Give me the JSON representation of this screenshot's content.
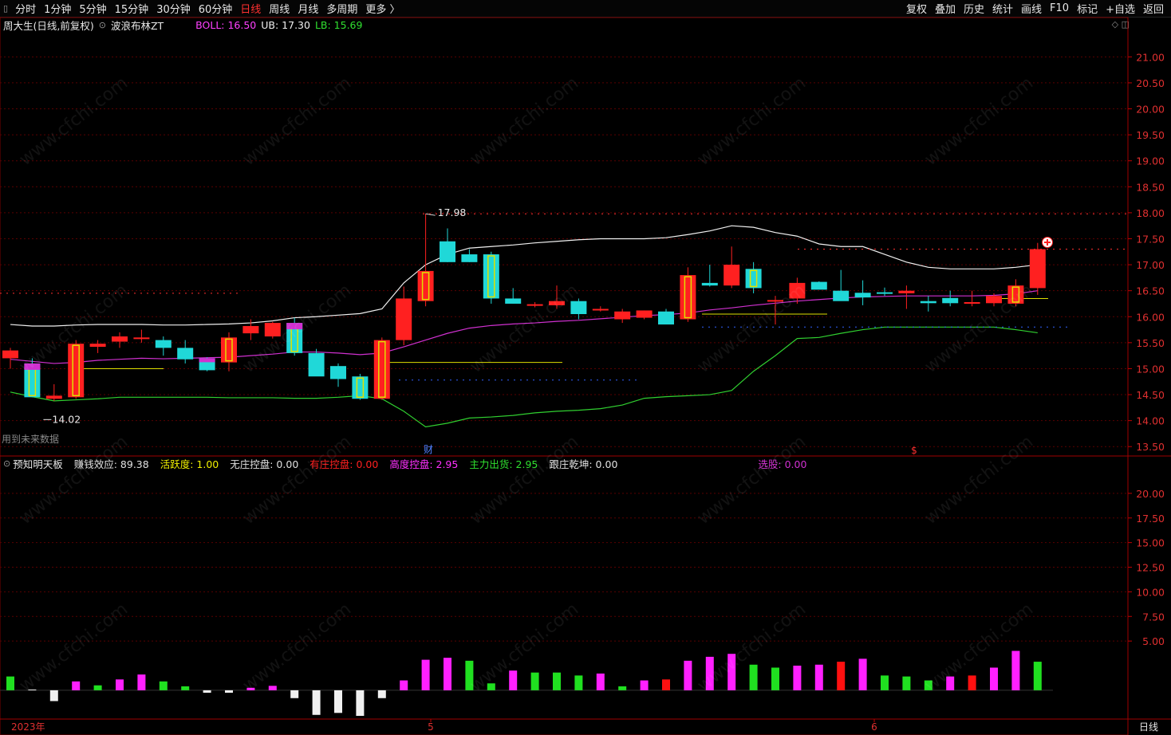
{
  "toolbar": {
    "left": [
      "分时",
      "1分钟",
      "5分钟",
      "15分钟",
      "30分钟",
      "60分钟",
      "日线",
      "周线",
      "月线",
      "多周期",
      "更多 〉"
    ],
    "active": "日线",
    "right": [
      "复权",
      "叠加",
      "历史",
      "统计",
      "画线",
      "F10",
      "标记",
      "+自选",
      "返回"
    ]
  },
  "main_info": {
    "stock": "周大生(日线,前复权)",
    "indicator": "波浪布林ZT",
    "boll_label": "BOLL: 16.50",
    "ub_label": "UB: 17.30",
    "lb_label": "LB: 15.69"
  },
  "sub_info": {
    "name": "预知明天板",
    "items": [
      {
        "text": "赚钱效应: 89.38",
        "color": "#e0e0e0"
      },
      {
        "text": "活跃度: 1.00",
        "color": "#f0f000"
      },
      {
        "text": "无庄控盘: 0.00",
        "color": "#e0e0e0"
      },
      {
        "text": "有庄控盘: 0.00",
        "color": "#ff2020"
      },
      {
        "text": "高度控盘: 2.95",
        "color": "#ff30ff"
      },
      {
        "text": "主力出货: 2.95",
        "color": "#30e030"
      },
      {
        "text": "跟庄乾坤: 0.00",
        "color": "#e0e0e0"
      }
    ],
    "select_label": "选股: 0.00"
  },
  "annotations": {
    "high_label": "17.98",
    "low_label": "14.02",
    "future_note": "用到未来数据",
    "cai": "财",
    "dollar": "$"
  },
  "x_labels": {
    "start": "2023年",
    "m5": "5",
    "m6": "6",
    "period": "日线"
  },
  "watermark": "www.cfchi.com",
  "colors": {
    "up": "#ff2020",
    "down": "#20d8d8",
    "mid": "#d030d0",
    "upper": "#f0f0f0",
    "lower": "#30d030",
    "yellow": "#e0e000"
  },
  "chart_data": [
    {
      "type": "candlestick",
      "title": "周大生(日线,前复权) 波浪布林ZT",
      "ylim": [
        13.35,
        21.45
      ],
      "y_ticks": [
        "21.00",
        "20.50",
        "20.00",
        "19.50",
        "19.00",
        "18.50",
        "18.00",
        "17.50",
        "17.00",
        "16.50",
        "16.00",
        "15.50",
        "15.00",
        "14.50",
        "14.00",
        "13.50"
      ],
      "ohlc": [
        [
          15.2,
          15.4,
          15.0,
          15.35
        ],
        [
          15.1,
          15.2,
          14.45,
          14.45
        ],
        [
          14.42,
          14.7,
          14.38,
          14.48
        ],
        [
          14.45,
          15.55,
          14.42,
          15.48
        ],
        [
          15.42,
          15.55,
          15.3,
          15.48
        ],
        [
          15.52,
          15.7,
          15.4,
          15.62
        ],
        [
          15.58,
          15.75,
          15.5,
          15.6
        ],
        [
          15.55,
          15.62,
          15.25,
          15.4
        ],
        [
          15.4,
          15.55,
          15.1,
          15.18
        ],
        [
          15.2,
          15.22,
          14.95,
          14.97
        ],
        [
          15.12,
          15.7,
          14.95,
          15.6
        ],
        [
          15.68,
          15.95,
          15.55,
          15.82
        ],
        [
          15.62,
          15.9,
          15.58,
          15.88
        ],
        [
          15.88,
          15.98,
          15.25,
          15.3
        ],
        [
          15.3,
          15.38,
          14.9,
          14.85
        ],
        [
          15.05,
          15.1,
          14.65,
          14.8
        ],
        [
          14.85,
          14.9,
          14.4,
          14.42
        ],
        [
          14.42,
          15.6,
          14.4,
          15.55
        ],
        [
          15.55,
          16.58,
          15.45,
          16.35
        ],
        [
          16.3,
          17.98,
          16.2,
          16.88
        ],
        [
          17.45,
          17.7,
          17.05,
          17.05
        ],
        [
          17.2,
          17.3,
          17.05,
          17.05
        ],
        [
          17.2,
          17.25,
          16.25,
          16.35
        ],
        [
          16.35,
          16.55,
          16.25,
          16.25
        ],
        [
          16.22,
          16.28,
          16.18,
          16.24
        ],
        [
          16.22,
          16.6,
          16.15,
          16.3
        ],
        [
          16.3,
          16.35,
          15.95,
          16.05
        ],
        [
          16.15,
          16.2,
          16.1,
          16.15
        ],
        [
          15.95,
          16.15,
          15.88,
          16.1
        ],
        [
          15.98,
          16.12,
          15.95,
          16.12
        ],
        [
          16.1,
          16.15,
          15.88,
          15.85
        ],
        [
          15.95,
          16.95,
          15.9,
          16.8
        ],
        [
          16.65,
          17.0,
          16.58,
          16.6
        ],
        [
          16.6,
          17.35,
          16.55,
          17.0
        ],
        [
          16.92,
          17.05,
          16.45,
          16.55
        ],
        [
          16.32,
          16.4,
          15.85,
          16.32
        ],
        [
          16.35,
          16.75,
          16.25,
          16.65
        ],
        [
          16.67,
          16.68,
          16.55,
          16.52
        ],
        [
          16.5,
          16.9,
          16.4,
          16.3
        ],
        [
          16.46,
          16.7,
          16.22,
          16.37
        ],
        [
          16.47,
          16.56,
          16.4,
          16.44
        ],
        [
          16.45,
          16.6,
          16.15,
          16.5
        ],
        [
          16.3,
          16.4,
          16.1,
          16.26
        ],
        [
          16.36,
          16.5,
          16.2,
          16.26
        ],
        [
          16.26,
          16.5,
          16.2,
          16.28
        ],
        [
          16.26,
          16.45,
          16.2,
          16.4
        ],
        [
          16.25,
          16.72,
          16.2,
          16.6
        ],
        [
          16.55,
          17.42,
          16.42,
          17.3
        ]
      ],
      "boll_mid": [
        15.18,
        15.14,
        15.1,
        15.12,
        15.16,
        15.18,
        15.2,
        15.19,
        15.2,
        15.21,
        15.22,
        15.25,
        15.28,
        15.32,
        15.32,
        15.3,
        15.27,
        15.3,
        15.42,
        15.55,
        15.68,
        15.78,
        15.83,
        15.86,
        15.88,
        15.91,
        15.93,
        15.96,
        15.99,
        16.02,
        16.04,
        16.07,
        16.13,
        16.17,
        16.22,
        16.26,
        16.3,
        16.33,
        16.36,
        16.38,
        16.39,
        16.4,
        16.4,
        16.4,
        16.4,
        16.41,
        16.44,
        16.5
      ],
      "boll_upper": [
        15.85,
        15.82,
        15.82,
        15.84,
        15.85,
        15.85,
        15.85,
        15.84,
        15.84,
        15.85,
        15.86,
        15.88,
        15.92,
        15.98,
        16.0,
        16.03,
        16.06,
        16.15,
        16.65,
        17.0,
        17.2,
        17.32,
        17.35,
        17.38,
        17.42,
        17.45,
        17.48,
        17.5,
        17.5,
        17.5,
        17.52,
        17.58,
        17.65,
        17.75,
        17.72,
        17.62,
        17.55,
        17.4,
        17.35,
        17.35,
        17.2,
        17.05,
        16.95,
        16.92,
        16.92,
        16.92,
        16.95,
        17.0
      ],
      "boll_lower": [
        14.55,
        14.46,
        14.38,
        14.4,
        14.42,
        14.45,
        14.45,
        14.45,
        14.45,
        14.45,
        14.44,
        14.44,
        14.44,
        14.43,
        14.43,
        14.45,
        14.48,
        14.42,
        14.18,
        13.88,
        13.95,
        14.05,
        14.07,
        14.1,
        14.15,
        14.18,
        14.2,
        14.23,
        14.3,
        14.43,
        14.46,
        14.48,
        14.5,
        14.58,
        14.95,
        15.25,
        15.58,
        15.6,
        15.68,
        15.75,
        15.8,
        15.8,
        15.8,
        15.8,
        15.8,
        15.8,
        15.75,
        15.69
      ],
      "ub": 17.3,
      "boll": 16.5,
      "lb": 15.69
    },
    {
      "type": "bar",
      "title": "预知明天板",
      "ylim": [
        -2.6,
        22.5
      ],
      "y_ticks": [
        "20.00",
        "17.50",
        "15.00",
        "12.50",
        "10.00",
        "7.50",
        "5.00"
      ],
      "values": [
        1.4,
        0.08,
        -1.1,
        0.9,
        0.5,
        1.1,
        1.6,
        0.9,
        0.4,
        -0.25,
        -0.25,
        0.25,
        0.45,
        -0.8,
        -2.5,
        -2.3,
        -2.6,
        -0.8,
        1.0,
        3.1,
        3.3,
        3.0,
        0.7,
        2.0,
        1.8,
        1.8,
        1.5,
        1.7,
        0.4,
        1.0,
        1.1,
        3.0,
        3.4,
        3.7,
        2.6,
        2.3,
        2.5,
        2.6,
        2.9,
        3.2,
        1.5,
        1.4,
        1.0,
        1.4,
        1.5,
        2.3,
        4.0,
        2.9
      ],
      "colors": [
        "g",
        "w",
        "w",
        "m",
        "g",
        "m",
        "m",
        "g",
        "g",
        "w",
        "w",
        "m",
        "m",
        "w",
        "w",
        "w",
        "w",
        "w",
        "m",
        "m",
        "m",
        "g",
        "g",
        "m",
        "g",
        "g",
        "g",
        "m",
        "g",
        "m",
        "r",
        "m",
        "m",
        "m",
        "g",
        "g",
        "m",
        "m",
        "r",
        "m",
        "g",
        "g",
        "g",
        "m",
        "r",
        "m",
        "m",
        "g"
      ]
    }
  ]
}
